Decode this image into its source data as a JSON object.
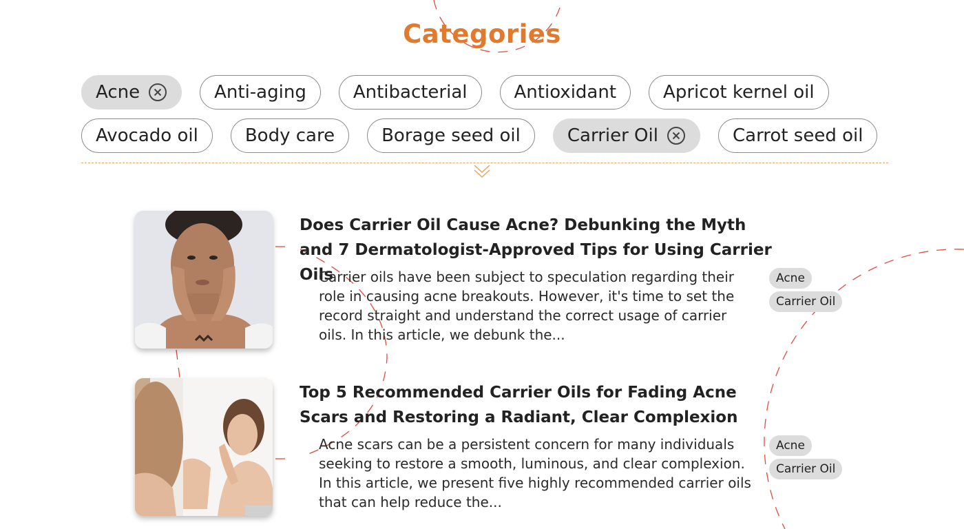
{
  "heading": "Categories",
  "categories": {
    "row1": [
      {
        "label": "Acne",
        "selected": true
      },
      {
        "label": "Anti-aging",
        "selected": false
      },
      {
        "label": "Antibacterial",
        "selected": false
      },
      {
        "label": "Antioxidant",
        "selected": false
      },
      {
        "label": "Apricot kernel oil",
        "selected": false
      }
    ],
    "row2": [
      {
        "label": "Avocado oil",
        "selected": false
      },
      {
        "label": "Body care",
        "selected": false
      },
      {
        "label": "Borage seed oil",
        "selected": false
      },
      {
        "label": "Carrier Oil",
        "selected": true
      },
      {
        "label": "Carrot seed oil",
        "selected": false
      }
    ]
  },
  "icons": {
    "remove": "close-circle-icon",
    "expand": "chevron-down-icon"
  },
  "colors": {
    "accent": "#e07a2e",
    "selected_chip": "#dcdcdc",
    "decorative_dash": "#e14b3c"
  },
  "articles": [
    {
      "title": "Does Carrier Oil Cause Acne? Debunking the Myth and 7 Dermatologist-Approved Tips for Using Carrier Oils",
      "excerpt": "Carrier oils have been subject to speculation regarding their role in causing acne breakouts. However, it's time to set the record straight and understand the correct usage of carrier oils. In this article, we debunk the...",
      "tags": [
        "Acne",
        "Carrier Oil"
      ]
    },
    {
      "title": "Top 5 Recommended Carrier Oils for Fading Acne Scars and Restoring a Radiant, Clear Complexion",
      "excerpt": "Acne scars can be a persistent concern for many individuals seeking to restore a smooth, luminous, and clear complexion. In this article, we present five highly recommended carrier oils that can help reduce the...",
      "tags": [
        "Acne",
        "Carrier Oil"
      ]
    }
  ]
}
